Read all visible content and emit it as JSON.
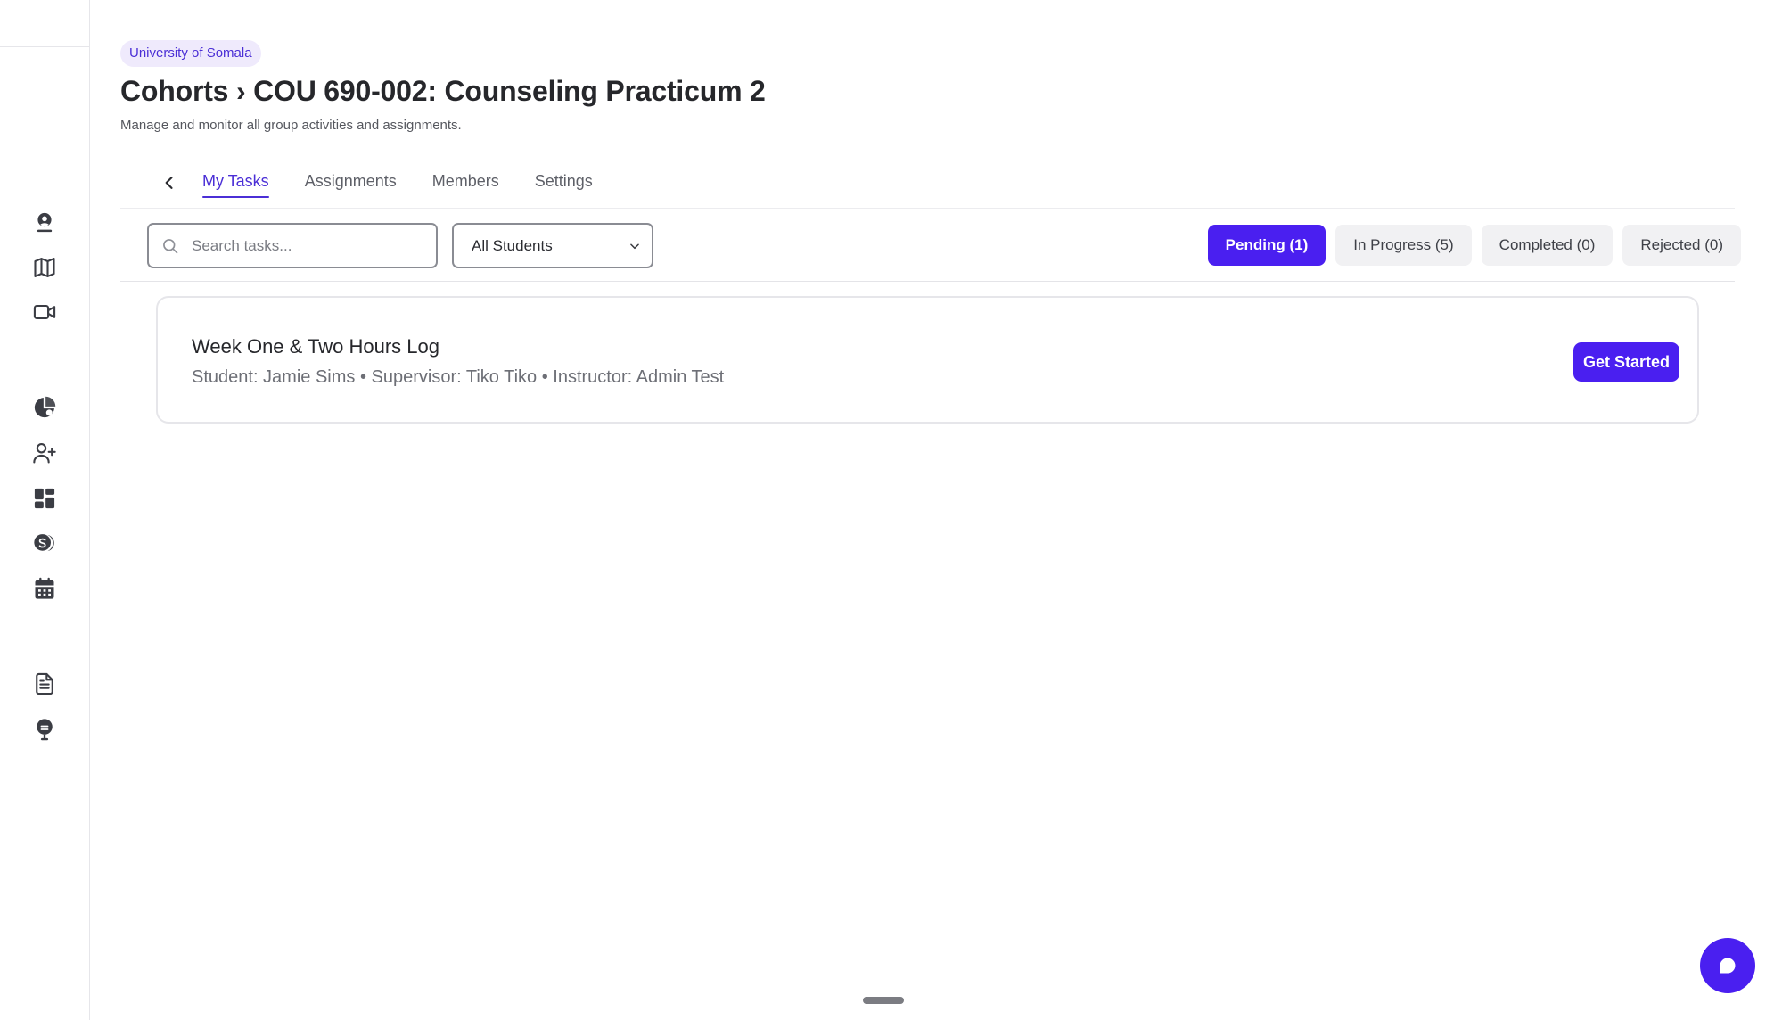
{
  "header": {
    "org_badge": "University of Somala",
    "title": "Cohorts › COU 690-002: Counseling Practicum 2",
    "subtitle": "Manage and monitor all group activities and assignments."
  },
  "sidebar": {
    "icons": [
      "user-pin-icon",
      "map-icon",
      "video-icon",
      "chart-pie-icon",
      "user-add-icon",
      "dashboard-icon",
      "coins-icon",
      "calendar-icon",
      "document-icon",
      "microphone-icon"
    ]
  },
  "tabs": [
    {
      "label": "My Tasks",
      "active": true
    },
    {
      "label": "Assignments",
      "active": false
    },
    {
      "label": "Members",
      "active": false
    },
    {
      "label": "Settings",
      "active": false
    }
  ],
  "toolbar": {
    "search_placeholder": "Search tasks...",
    "student_filter": "All Students",
    "status_filters": [
      {
        "label": "Pending (1)",
        "active": true
      },
      {
        "label": "In Progress (5)",
        "active": false
      },
      {
        "label": "Completed (0)",
        "active": false
      },
      {
        "label": "Rejected (0)",
        "active": false
      }
    ]
  },
  "tasks": [
    {
      "title": "Week One & Two Hours Log",
      "meta": "Student: Jamie Sims • Supervisor: Tiko Tiko • Instructor: Admin Test",
      "action_label": "Get Started"
    }
  ],
  "colors": {
    "accent": "#4a1ff0",
    "badge_bg": "#efeafc",
    "badge_text": "#4b2fd6"
  }
}
